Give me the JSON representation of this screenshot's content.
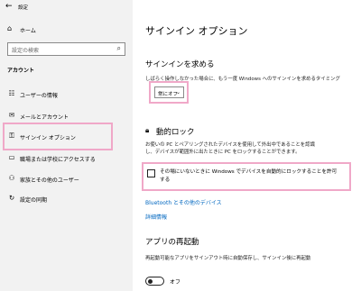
{
  "window": {
    "title": "設定"
  },
  "sidebar": {
    "home_label": "ホーム",
    "search_placeholder": "設定の検索",
    "section_title": "アカウント",
    "items": [
      {
        "label": "ユーザーの情報",
        "icon": "user-info-icon"
      },
      {
        "label": "メールとアカウント",
        "icon": "mail-icon"
      },
      {
        "label": "サインイン オプション",
        "icon": "key-icon"
      },
      {
        "label": "職場または学校にアクセスする",
        "icon": "briefcase-icon"
      },
      {
        "label": "家族とその他のユーザー",
        "icon": "family-icon"
      },
      {
        "label": "設定の同期",
        "icon": "sync-icon"
      }
    ]
  },
  "main": {
    "page_title": "サインイン オプション",
    "require_signin": {
      "heading": "サインインを求める",
      "description": "しばらく操作しなかった場合に、もう一度 Windows へのサインインを求めるタイミング",
      "dropdown_value": "常にオフ"
    },
    "dynamic_lock": {
      "heading": "動的ロック",
      "description_line1": "お使いの PC とペアリングされたデバイスを使用して外出中であることを認識",
      "description_line2": "し、デバイスが範囲外に出たときに PC をロックすることができます。",
      "checkbox_label": "その場にいないときに Windows でデバイスを自動的にロックすることを許可する",
      "checkbox_checked": false,
      "bluetooth_link": "Bluetooth とその他のデバイス",
      "details_link": "詳細情報"
    },
    "app_restart": {
      "heading": "アプリの再起動",
      "description": "再起動可能なアプリをサインアウト時に自動保存し、サインイン後に再起動",
      "toggle_label": "オフ",
      "toggle_on": false
    }
  },
  "colors": {
    "highlight": "#f0a8c8",
    "link": "#0067c0",
    "sidebar_bg": "#f2f2f2"
  }
}
